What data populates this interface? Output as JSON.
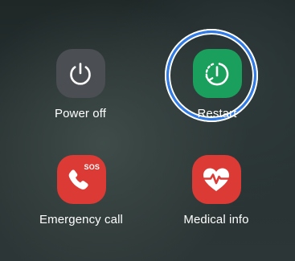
{
  "power_menu": {
    "options": [
      {
        "id": "power-off",
        "label": "Power off",
        "icon": "power-icon",
        "color": "#4b4e52"
      },
      {
        "id": "restart",
        "label": "Restart",
        "icon": "restart-icon",
        "color": "#1aa05c",
        "focused": true
      },
      {
        "id": "emergency-call",
        "label": "Emergency call",
        "icon": "emergency-call-icon",
        "badge": "SOS",
        "color": "#dc3a35"
      },
      {
        "id": "medical-info",
        "label": "Medical info",
        "icon": "medical-heart-icon",
        "color": "#dc3a35"
      }
    ],
    "focus_ring_color": "#2f7bea"
  }
}
